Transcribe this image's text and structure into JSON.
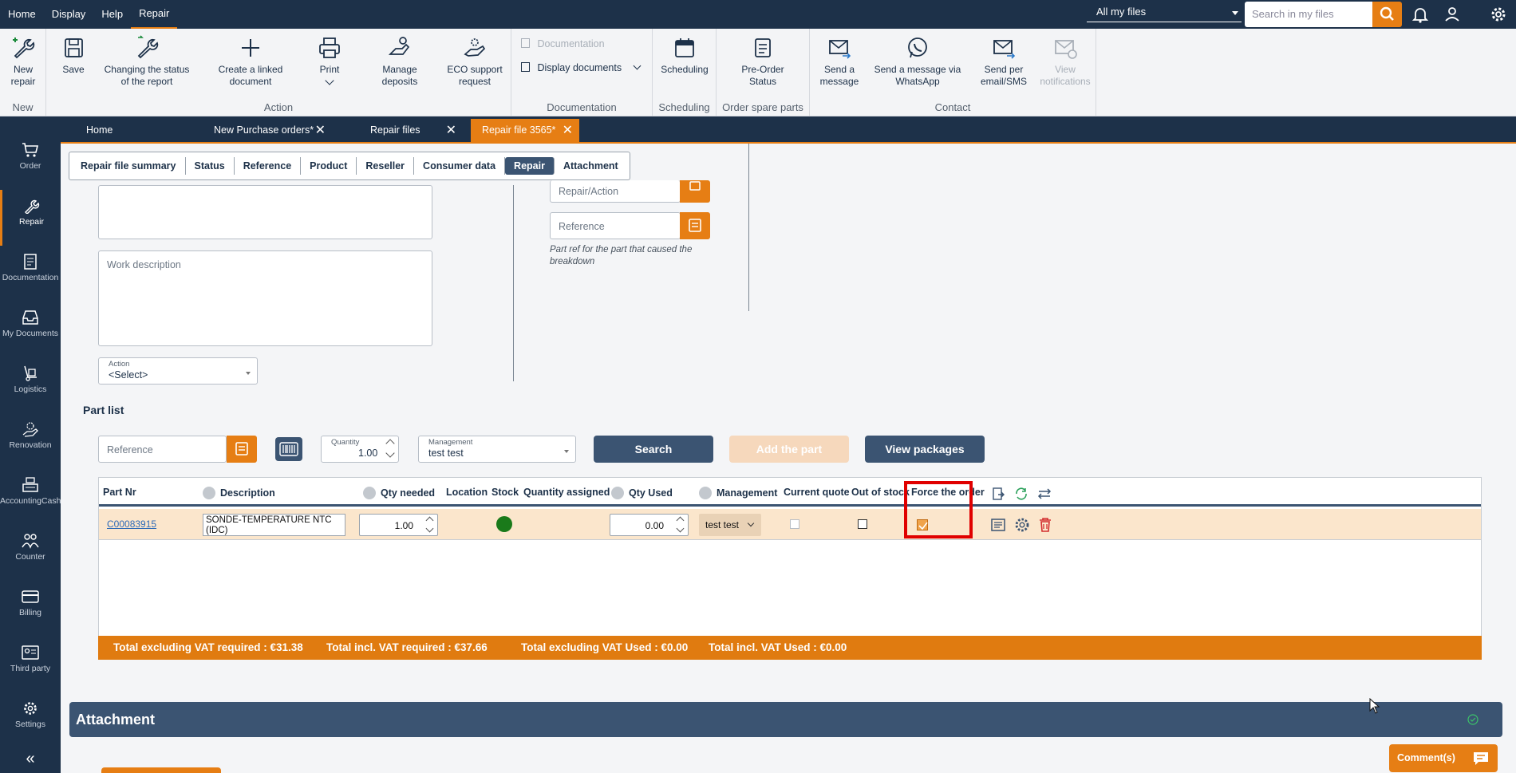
{
  "topbar": {
    "menu": [
      "Home",
      "Display",
      "Help",
      "Repair"
    ],
    "active_menu": "Repair",
    "files_filter": "All my files",
    "search_placeholder": "Search in my files"
  },
  "ribbon": {
    "groups": {
      "new": "New",
      "action": "Action",
      "documentation": "Documentation",
      "scheduling": "Scheduling",
      "order_spare_parts": "Order spare parts",
      "contact": "Contact"
    },
    "buttons": {
      "new_repair": "New repair",
      "save": "Save",
      "change_status": "Changing the status of the report",
      "create_linked": "Create a linked document",
      "print": "Print",
      "manage_deposits": "Manage deposits",
      "eco_support": "ECO support request",
      "documentation": "Documentation",
      "display_documents": "Display documents",
      "scheduling": "Scheduling",
      "preorder_status": "Pre-Order Status",
      "send_message": "Send a message",
      "send_whatsapp": "Send a message via WhatsApp",
      "send_email_sms": "Send per email/SMS",
      "view_notifications": "View notifications"
    }
  },
  "sidebar": {
    "items": [
      "Order",
      "Repair",
      "Documentation",
      "My Documents",
      "Logistics",
      "Renovation",
      "AccountingCash",
      "Counter",
      "Billing",
      "Third party",
      "Settings"
    ],
    "collapse": "«"
  },
  "doc_tabs": [
    {
      "label": "Home"
    },
    {
      "label": "New Purchase orders*"
    },
    {
      "label": "Repair files"
    },
    {
      "label": "Repair file 3565*"
    }
  ],
  "close_glyph": "✕",
  "sub_tabs": [
    "Repair file summary",
    "Status",
    "Reference",
    "Product",
    "Reseller",
    "Consumer data",
    "Repair",
    "Attachment"
  ],
  "active_sub_tab": "Repair",
  "repair_form": {
    "work_description_placeholder": "Work description",
    "action_label": "Action",
    "action_value": "<Select>",
    "repair_action_placeholder": "Repair/Action",
    "reference_placeholder": "Reference",
    "part_ref_note": "Part ref for the part that caused the breakdown"
  },
  "part_list": {
    "title": "Part list",
    "reference_placeholder": "Reference",
    "quantity_label": "Quantity",
    "quantity_value": "1.00",
    "management_label": "Management",
    "management_value": "test test",
    "search_button": "Search",
    "add_part_button": "Add the part",
    "view_packages_button": "View packages",
    "columns": [
      "Part Nr",
      "Description",
      "Qty needed",
      "Location",
      "Stock",
      "Quantity assigned",
      "Qty Used",
      "Management",
      "Current quote",
      "Out of stock",
      "Force the order"
    ],
    "rows": [
      {
        "part_nr": "C00083915",
        "description": "SONDE-TEMPERATURE NTC (IDC)",
        "qty_needed": "1.00",
        "stock_color": "#1a7a1a",
        "qty_used": "0.00",
        "management": "test test",
        "current_quote": false,
        "out_of_stock": false,
        "force_order": true
      }
    ],
    "totals": {
      "excl_vat_required": "Total excluding VAT required : €31.38",
      "incl_vat_required": "Total incl. VAT required : €37.66",
      "excl_vat_used": "Total excluding VAT Used : €0.00",
      "incl_vat_used": "Total incl. VAT Used : €0.00"
    }
  },
  "attachment": {
    "title": "Attachment"
  },
  "comments_button": "Comment(s)",
  "colors": {
    "accent": "#e67e14",
    "navy": "#1d3149",
    "highlight": "#e00000"
  }
}
